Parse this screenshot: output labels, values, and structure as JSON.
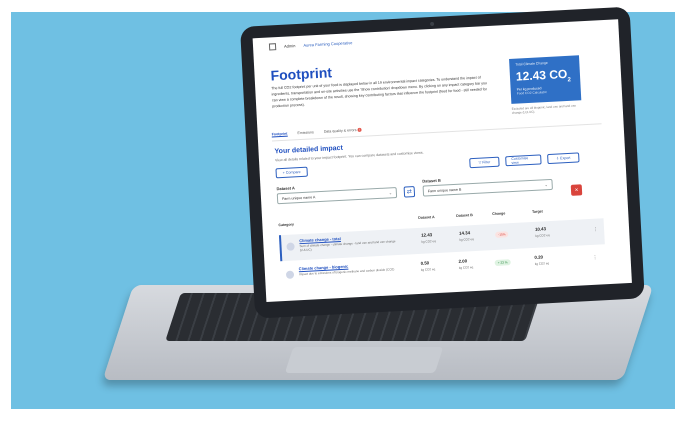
{
  "breadcrumb": {
    "items": [
      "Admin",
      "Aurea Farming Cooperative"
    ]
  },
  "page": {
    "title": "Footprint",
    "description": "The full CO2 footprint per unit of your food is displayed below in all 19 environmental impact categories. To understand the impact of ingredients, transportation and on-site activities use the 'Show contribution' dropdown menu. By clicking on any impact category bar you can view a complete breakdown of the result, showing key contributing factors that influence the footprint (feed for food - still needed for production process)."
  },
  "score_card": {
    "label": "Total Climate Change",
    "value": "12.43 CO",
    "subscript": "2",
    "unit": "Per kg produced",
    "source": "Food CO2 Calculator",
    "note": "Excluded are all biogenic, land use and land use change (LULUC)."
  },
  "tabs": [
    {
      "label": "Footprint"
    },
    {
      "label": "Emissions"
    },
    {
      "label": "Data quality & errors"
    }
  ],
  "detail": {
    "title": "Your detailed impact",
    "subtitle": "View all details related to your impact footprint. You can compare datasets and customise views.",
    "compare_label": "+ Compare",
    "filter_label": "Filter",
    "customise_label": "Customise view",
    "export_label": "Export"
  },
  "datasets": {
    "a_label": "Dataset A",
    "a_value": "Farm unique name A",
    "b_label": "Dataset B",
    "b_value": "Farm unique name B"
  },
  "table": {
    "columns": [
      "Category",
      "Dataset A",
      "Dataset B",
      "Change",
      "Target"
    ],
    "rows": [
      {
        "name": "Climate change - total",
        "desc": "Sum of climate change - climate change - land use and land use change (LULUC)",
        "a": "12.43",
        "a_unit": "kg CO2 eq",
        "b": "14.34",
        "b_unit": "kg CO2 eq",
        "change": "-15%",
        "change_type": "red",
        "target": "10.43",
        "target_unit": "kg CO2 eq"
      },
      {
        "name": "Climate change - biogenic",
        "desc": "Impact due to emissions of biogenic methane and carbon dioxide (CO2)",
        "a": "0.50",
        "a_unit": "kg CO2 eq",
        "b": "2.00",
        "b_unit": "kg CO2 eq",
        "change": "+ 23 %",
        "change_type": "green",
        "target": "0.20",
        "target_unit": "kg CO2 eq"
      }
    ]
  },
  "icons": {
    "home": "home-icon",
    "swap": "swap-icon",
    "delete": "trash-icon",
    "filter": "filter-icon",
    "export": "export-icon"
  },
  "colors": {
    "background": "#6fc0e3",
    "primary": "#1f4fbf",
    "score_card": "#2f70c6",
    "danger": "#d9443c"
  }
}
